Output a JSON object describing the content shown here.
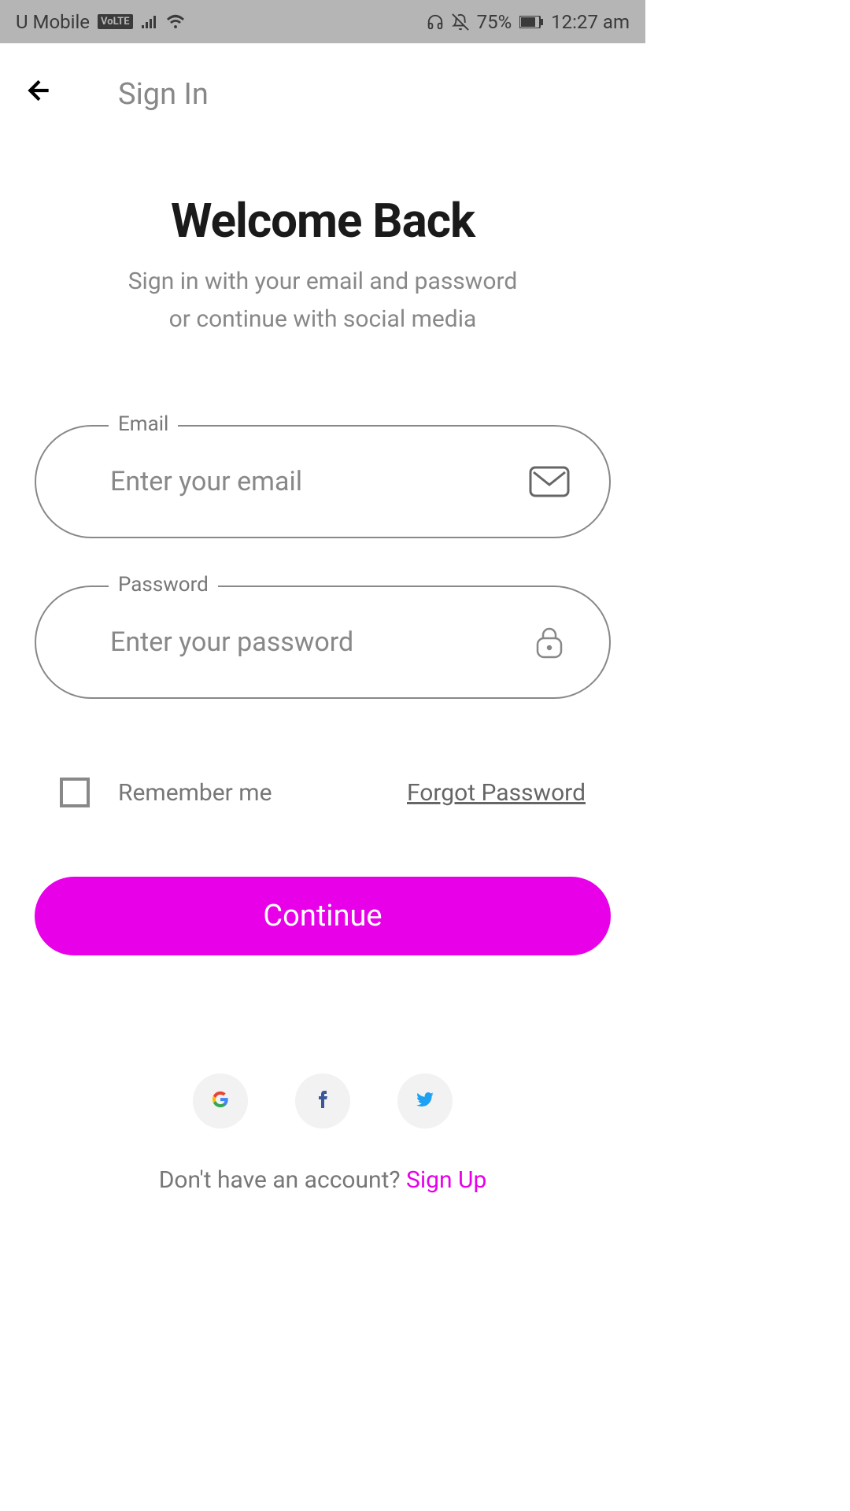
{
  "status_bar": {
    "carrier": "U Mobile",
    "volte": "VoLTE",
    "battery": "75%",
    "time": "12:27 am"
  },
  "app_bar": {
    "title": "Sign In"
  },
  "welcome": {
    "title": "Welcome Back",
    "subtitle_line1": "Sign in with your email and password",
    "subtitle_line2": "or continue with social media"
  },
  "form": {
    "email": {
      "label": "Email",
      "placeholder": "Enter your email"
    },
    "password": {
      "label": "Password",
      "placeholder": "Enter your password"
    },
    "remember_label": "Remember me",
    "forgot_label": "Forgot Password",
    "continue_label": "Continue"
  },
  "footer": {
    "no_account": "Don't have an account? ",
    "signup": "Sign Up"
  },
  "colors": {
    "accent": "#e800e8"
  }
}
